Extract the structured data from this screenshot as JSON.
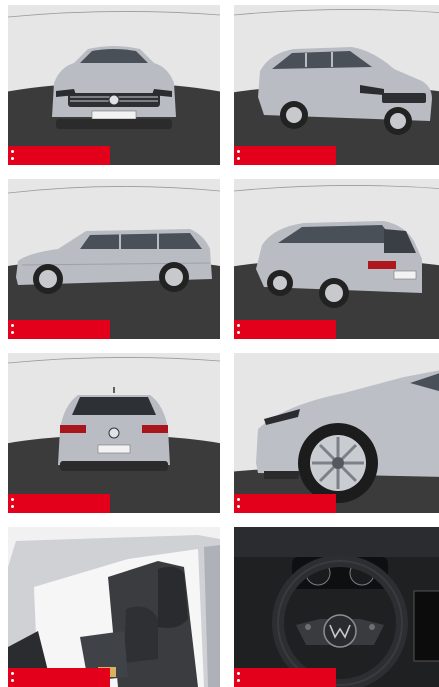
{
  "gallery": {
    "photos": [
      {
        "subject": "front-exterior",
        "icon": "car-front-view-icon"
      },
      {
        "subject": "front-three-quarter-exterior",
        "icon": "car-front-angle-icon"
      },
      {
        "subject": "side-profile-exterior",
        "icon": "car-side-view-icon"
      },
      {
        "subject": "rear-three-quarter-exterior",
        "icon": "car-rear-angle-icon"
      },
      {
        "subject": "rear-exterior",
        "icon": "car-rear-view-icon"
      },
      {
        "subject": "front-wheel-detail",
        "icon": "wheel-detail-icon"
      },
      {
        "subject": "front-seats-interior",
        "icon": "car-seat-icon"
      },
      {
        "subject": "steering-wheel-interior",
        "icon": "steering-wheel-icon"
      }
    ],
    "badge_color": "#e2001a",
    "car_color": "#b9bcc2",
    "backdrop_color": "#e6e6e6",
    "floor_color": "#3a3a3a"
  }
}
